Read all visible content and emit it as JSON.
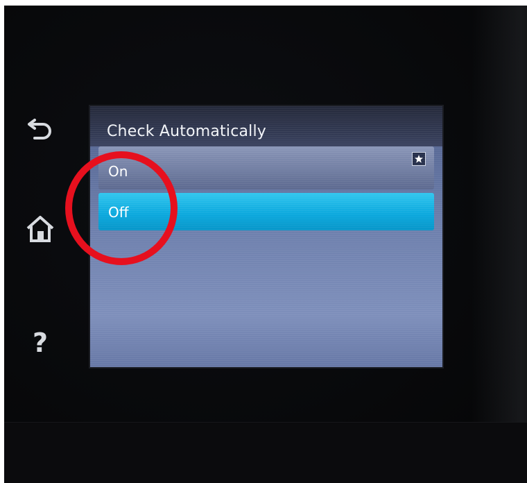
{
  "screen": {
    "title": "Check Automatically",
    "options": [
      {
        "label": "On",
        "selected": false,
        "badge_icon": "star-icon"
      },
      {
        "label": "Off",
        "selected": true
      }
    ]
  },
  "side_buttons": [
    {
      "icon": "back-arrow-icon"
    },
    {
      "icon": "home-icon"
    },
    {
      "icon": "help-icon",
      "glyph": "?"
    }
  ],
  "annotation": {
    "shape": "circle",
    "color": "#e6101e",
    "target": "Off"
  },
  "colors": {
    "selected_option": "#0aa7dc",
    "screen_background": "#6d7fac",
    "title_bar": "#2b3247"
  }
}
